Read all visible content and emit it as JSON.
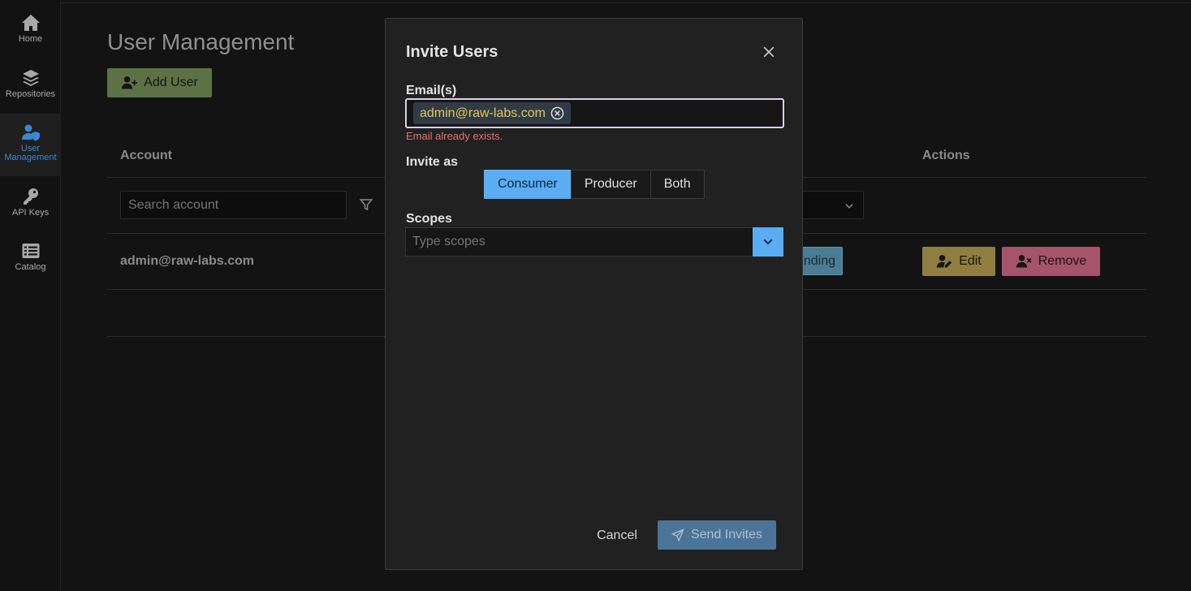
{
  "sidebar": {
    "items": [
      {
        "label": "Home",
        "icon": "home-icon"
      },
      {
        "label": "Repositories",
        "icon": "layers-icon"
      },
      {
        "label": "User Management",
        "icon": "user-shield-icon",
        "active": true
      },
      {
        "label": "API Keys",
        "icon": "key-icon"
      },
      {
        "label": "Catalog",
        "icon": "list-icon"
      }
    ]
  },
  "page": {
    "title": "User Management",
    "add_user_label": "Add User",
    "table": {
      "columns": {
        "account": "Account",
        "actions": "Actions"
      },
      "search_placeholder": "Search account",
      "rows": [
        {
          "account": "admin@raw-labs.com",
          "status": "nding",
          "edit_label": "Edit",
          "remove_label": "Remove"
        }
      ]
    }
  },
  "modal": {
    "title": "Invite Users",
    "emails_label": "Email(s)",
    "email_chip": "admin@raw-labs.com",
    "error": "Email already exists.",
    "invite_as_label": "Invite as",
    "roles": [
      "Consumer",
      "Producer",
      "Both"
    ],
    "selected_role": "Consumer",
    "scopes_label": "Scopes",
    "scopes_placeholder": "Type scopes",
    "cancel_label": "Cancel",
    "send_label": "Send Invites"
  },
  "colors": {
    "accent_blue": "#5aacf3",
    "add_green": "#5d7146",
    "edit_gold": "#8f7e3f",
    "remove_pink": "#a6536e",
    "error_red": "#e37070",
    "chip_text": "#e5c654"
  }
}
